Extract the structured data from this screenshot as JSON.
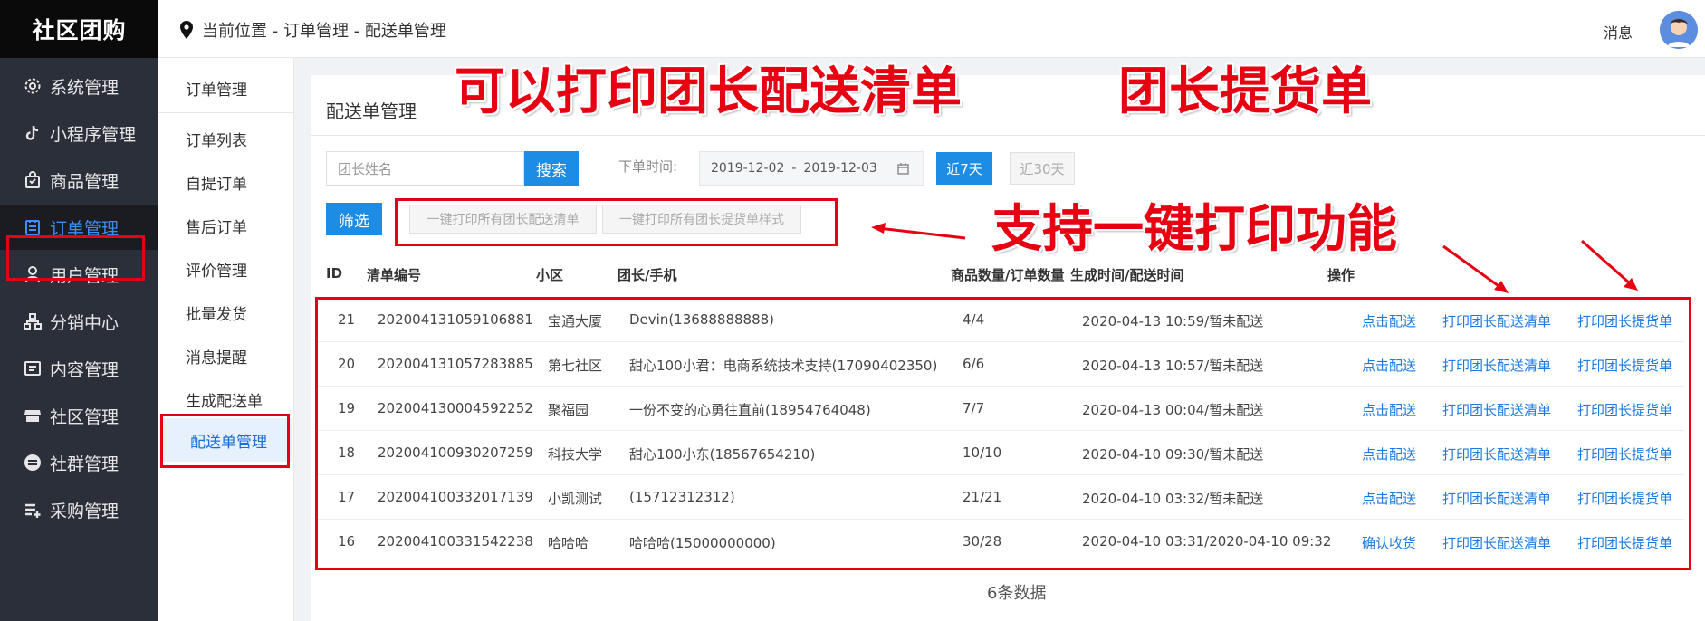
{
  "brand": "社区团购",
  "sidebar": {
    "items": [
      {
        "label": "系统管理",
        "icon": "gear-icon"
      },
      {
        "label": "小程序管理",
        "icon": "tiktok-icon"
      },
      {
        "label": "商品管理",
        "icon": "bag-icon"
      },
      {
        "label": "订单管理",
        "icon": "order-icon"
      },
      {
        "label": "用户管理",
        "icon": "user-icon"
      },
      {
        "label": "分销中心",
        "icon": "network-icon"
      },
      {
        "label": "内容管理",
        "icon": "content-icon"
      },
      {
        "label": "社区管理",
        "icon": "store-icon"
      },
      {
        "label": "社群管理",
        "icon": "group-icon"
      },
      {
        "label": "采购管理",
        "icon": "purchase-icon"
      }
    ],
    "active_index": 3
  },
  "header": {
    "breadcrumb": "当前位置 - 订单管理 - 配送单管理",
    "messages_label": "消息"
  },
  "submenu": {
    "title": "订单管理",
    "items": [
      "订单列表",
      "自提订单",
      "售后订单",
      "评价管理",
      "批量发货",
      "消息提醒",
      "生成配送单",
      "配送单管理"
    ],
    "active_index": 7
  },
  "main": {
    "page_title": "配送单管理",
    "search": {
      "placeholder": "团长姓名",
      "button": "搜索"
    },
    "date_filter": {
      "label": "下单时间:",
      "start": "2019-12-02",
      "separator": "-",
      "end": "2019-12-03"
    },
    "quick_ranges": [
      "近7天",
      "近30天"
    ],
    "filter_button": "筛选",
    "batch_buttons": [
      "一键打印所有团长配送清单",
      "一键打印所有团长提货单样式"
    ],
    "table": {
      "columns": [
        "ID",
        "清单编号",
        "小区",
        "团长/手机",
        "商品数量/订单数量",
        "生成时间/配送时间",
        "操作"
      ],
      "rows": [
        {
          "id": "21",
          "no": "202004131059106881",
          "community": "宝通大厦",
          "leader": "Devin(13688888888)",
          "qty": "4/4",
          "time": "2020-04-13 10:59/暂未配送",
          "action1": "点击配送",
          "action2": "打印团长配送清单",
          "action3": "打印团长提货单"
        },
        {
          "id": "20",
          "no": "202004131057283885",
          "community": "第七社区",
          "leader": "甜心100小君：电商系统技术支持(17090402350)",
          "qty": "6/6",
          "time": "2020-04-13 10:57/暂未配送",
          "action1": "点击配送",
          "action2": "打印团长配送清单",
          "action3": "打印团长提货单"
        },
        {
          "id": "19",
          "no": "202004130004592252",
          "community": "聚福园",
          "leader": "一份不变的心勇往直前(18954764048)",
          "qty": "7/7",
          "time": "2020-04-13 00:04/暂未配送",
          "action1": "点击配送",
          "action2": "打印团长配送清单",
          "action3": "打印团长提货单"
        },
        {
          "id": "18",
          "no": "202004100930207259",
          "community": "科技大学",
          "leader": "甜心100小东(18567654210)",
          "qty": "10/10",
          "time": "2020-04-10 09:30/暂未配送",
          "action1": "点击配送",
          "action2": "打印团长配送清单",
          "action3": "打印团长提货单"
        },
        {
          "id": "17",
          "no": "202004100332017139",
          "community": "小凯测试",
          "leader": "(15712312312)",
          "qty": "21/21",
          "time": "2020-04-10 03:32/暂未配送",
          "action1": "点击配送",
          "action2": "打印团长配送清单",
          "action3": "打印团长提货单"
        },
        {
          "id": "16",
          "no": "202004100331542238",
          "community": "哈哈哈",
          "leader": "哈哈哈(15000000000)",
          "qty": "30/28",
          "time": "2020-04-10 03:31/2020-04-10 09:32",
          "action1": "确认收货",
          "action2": "打印团长配送清单",
          "action3": "打印团长提货单"
        }
      ]
    },
    "count_text": "6条数据"
  },
  "annotations": {
    "headline_1": "可以打印团长配送清单",
    "headline_2": "团长提货单",
    "headline_3": "支持一键打印功能"
  },
  "colors": {
    "accent": "#1c8ce4",
    "link": "#1c7ae0",
    "annotation_red": "#e60012",
    "sidebar_bg": "#2b2f3a"
  }
}
